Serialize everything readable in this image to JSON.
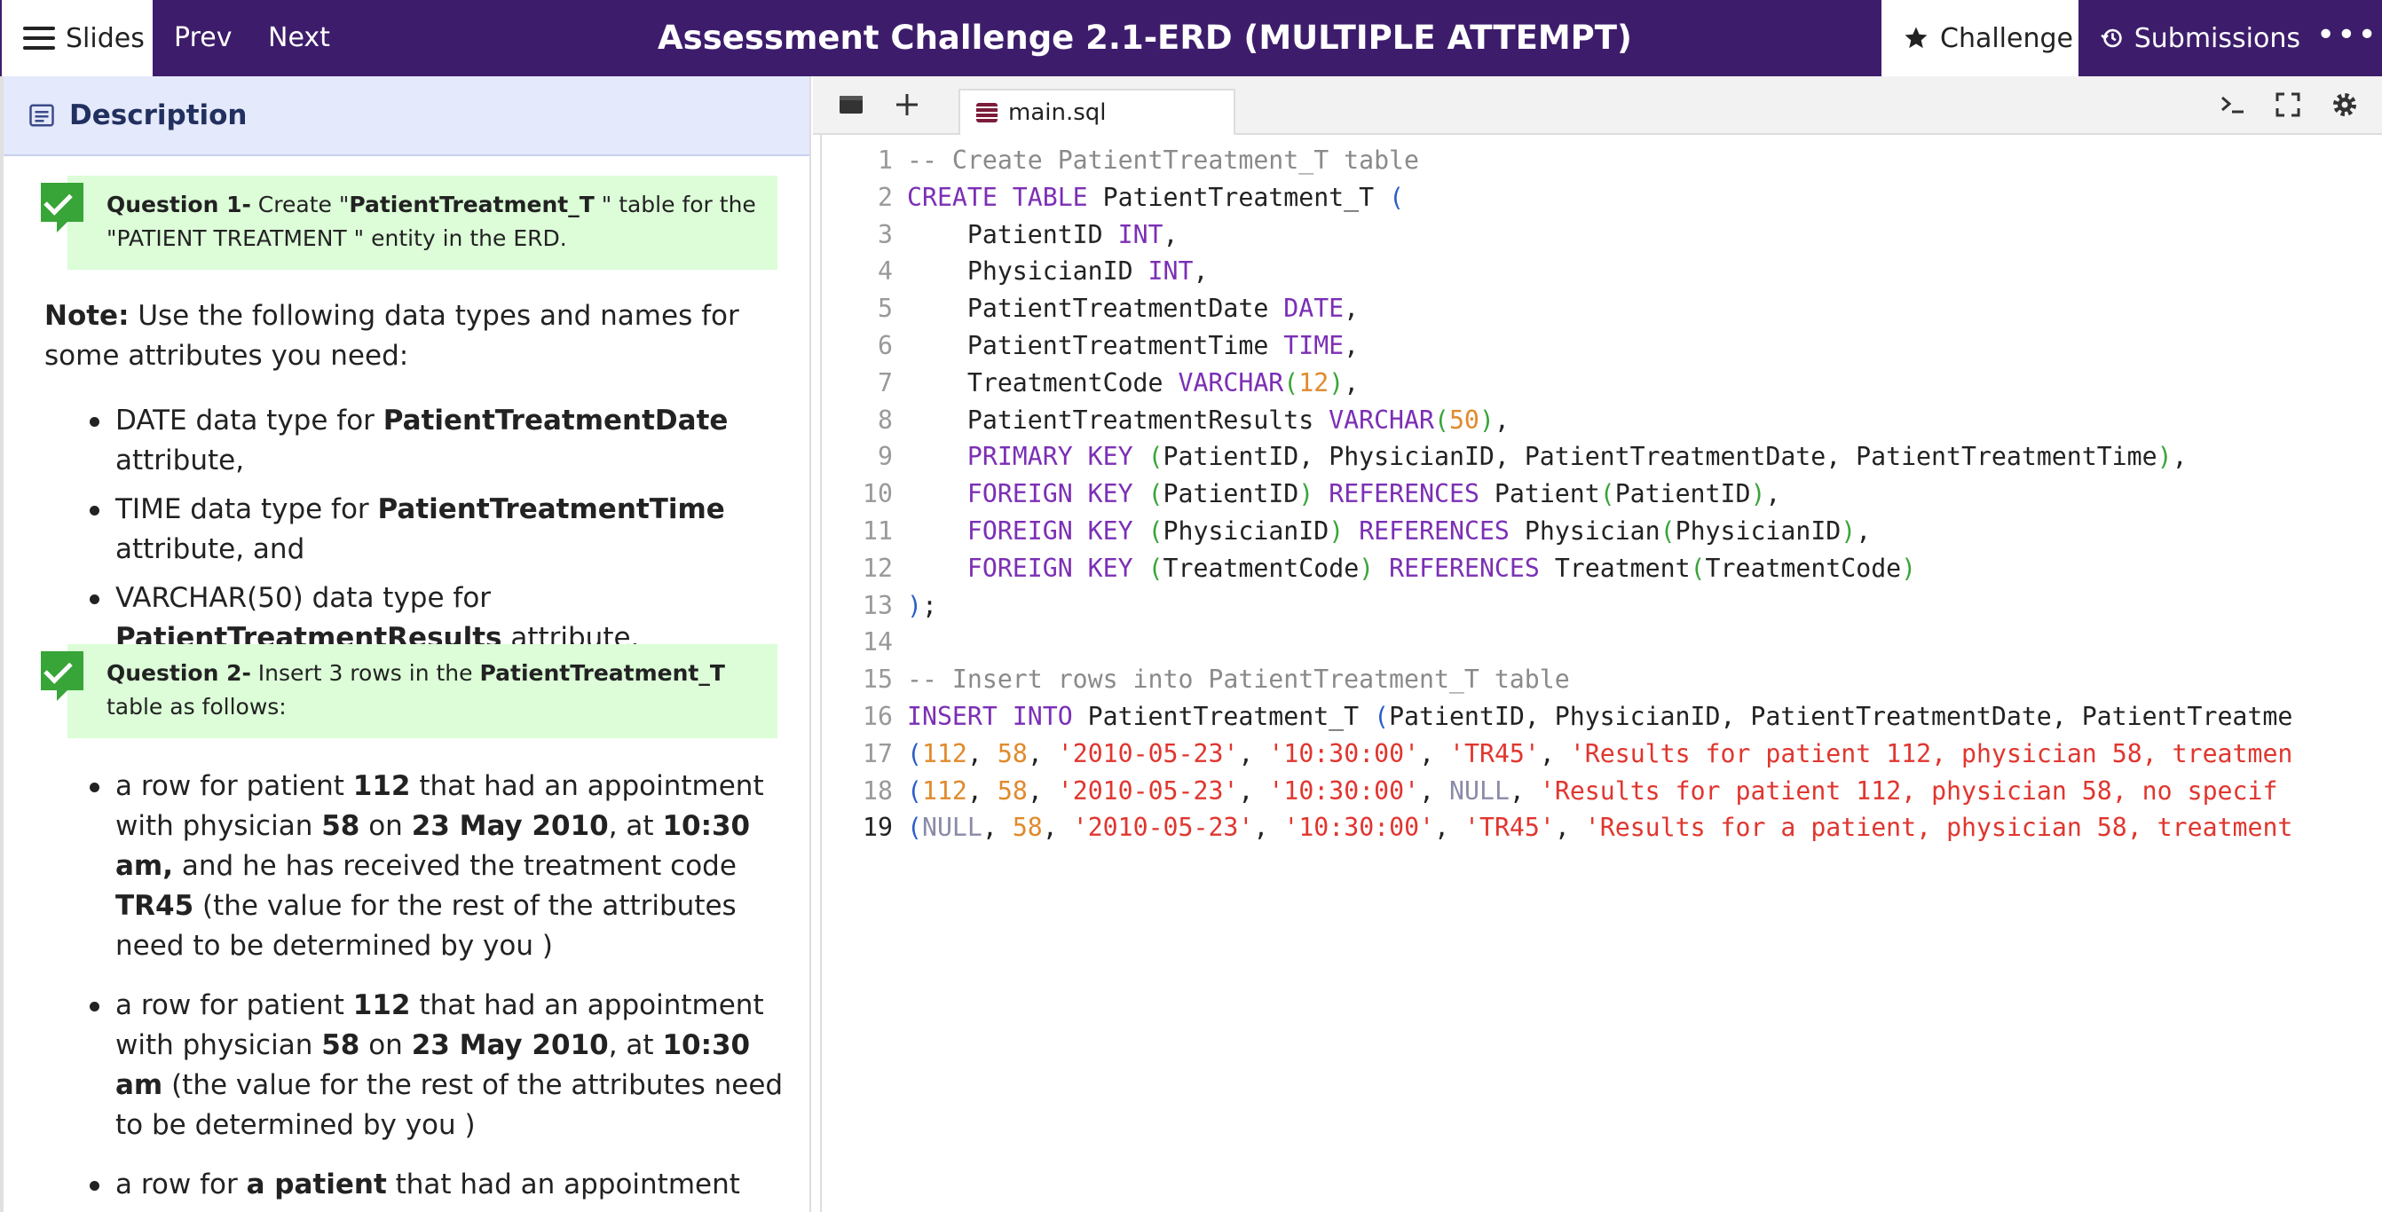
{
  "topbar": {
    "slides_label": "Slides",
    "prev_label": "Prev",
    "next_label": "Next",
    "title": "Assessment Challenge 2.1-ERD (MULTIPLE ATTEMPT)",
    "challenge_label": "Challenge",
    "submissions_label": "Submissions",
    "more_label": "•••"
  },
  "description": {
    "header": "Description",
    "q1": {
      "label": "Question 1-",
      "pre": " Create \"",
      "bold": "PatientTreatment_T",
      "post": " \" table for the \"PATIENT TREATMENT \" entity in the ERD."
    },
    "note": {
      "label": "Note:",
      "text": " Use the following data types and names for some attributes you need:"
    },
    "types": [
      {
        "pre": "DATE data type for ",
        "bold": "PatientTreatmentDate",
        "post": " attribute,"
      },
      {
        "pre": "TIME data type for ",
        "bold": "PatientTreatmentTime",
        "post": " attribute, and"
      },
      {
        "pre": "VARCHAR(50) data type for ",
        "bold": "PatientTreatmentResults",
        "post": " attribute."
      }
    ],
    "q2": {
      "label": "Question 2-",
      "pre": " Insert 3 rows in the ",
      "bold": "PatientTreatment_T",
      "post": " table as follows:"
    },
    "rows": [
      {
        "t1": "a row for patient ",
        "b1": "112",
        "t2": " that had an appointment with physician ",
        "b2": "58",
        "t3": " on ",
        "b3": "23 May 2010",
        "t4": ", at ",
        "b4": "10:30 am,",
        "t5": " and he has received the treatment code ",
        "b5": "TR45",
        "t6": "   (the value for the rest of the attributes need to be determined by you )"
      },
      {
        "t1": "a row for patient ",
        "b1": "112",
        "t2": " that had an appointment with physician ",
        "b2": "58",
        "t3": " on ",
        "b3": "23 May 2010",
        "t4": ", at ",
        "b4": "10:30 am",
        "t5": "  (the value for the rest of the attributes need to be determined by you )"
      },
      {
        "t1": "a row for ",
        "b1": "a patient",
        "t2": " that had an appointment with"
      }
    ]
  },
  "editor": {
    "tab_name": "main.sql",
    "icons": [
      "file-browser-icon",
      "plus-icon",
      "terminal-icon",
      "fullscreen-icon",
      "settings-icon"
    ],
    "current_line": 19,
    "lines": [
      {
        "n": "1",
        "tokens": [
          [
            "cm",
            "-- Create PatientTreatment_T table"
          ]
        ]
      },
      {
        "n": "2",
        "tokens": [
          [
            "kw",
            "CREATE TABLE"
          ],
          [
            "txt",
            " PatientTreatment_T "
          ],
          [
            "pb",
            "("
          ]
        ]
      },
      {
        "n": "3",
        "tokens": [
          [
            "txt",
            "    PatientID "
          ],
          [
            "ty",
            "INT"
          ],
          [
            "txt",
            ","
          ]
        ]
      },
      {
        "n": "4",
        "tokens": [
          [
            "txt",
            "    PhysicianID "
          ],
          [
            "ty",
            "INT"
          ],
          [
            "txt",
            ","
          ]
        ]
      },
      {
        "n": "5",
        "tokens": [
          [
            "txt",
            "    PatientTreatmentDate "
          ],
          [
            "ty",
            "DATE"
          ],
          [
            "txt",
            ","
          ]
        ]
      },
      {
        "n": "6",
        "tokens": [
          [
            "txt",
            "    PatientTreatmentTime "
          ],
          [
            "ty",
            "TIME"
          ],
          [
            "txt",
            ","
          ]
        ]
      },
      {
        "n": "7",
        "tokens": [
          [
            "txt",
            "    TreatmentCode "
          ],
          [
            "ty",
            "VARCHAR"
          ],
          [
            "pn",
            "("
          ],
          [
            "nm",
            "12"
          ],
          [
            "pn",
            ")"
          ],
          [
            "txt",
            ","
          ]
        ]
      },
      {
        "n": "8",
        "tokens": [
          [
            "txt",
            "    PatientTreatmentResults "
          ],
          [
            "ty",
            "VARCHAR"
          ],
          [
            "pn",
            "("
          ],
          [
            "nm",
            "50"
          ],
          [
            "pn",
            ")"
          ],
          [
            "txt",
            ","
          ]
        ]
      },
      {
        "n": "9",
        "tokens": [
          [
            "txt",
            "    "
          ],
          [
            "kw",
            "PRIMARY KEY"
          ],
          [
            "txt",
            " "
          ],
          [
            "pn",
            "("
          ],
          [
            "txt",
            "PatientID, PhysicianID, PatientTreatmentDate, PatientTreatmentTime"
          ],
          [
            "pn",
            ")"
          ],
          [
            "txt",
            ","
          ]
        ]
      },
      {
        "n": "10",
        "tokens": [
          [
            "txt",
            "    "
          ],
          [
            "kw",
            "FOREIGN KEY"
          ],
          [
            "txt",
            " "
          ],
          [
            "pn",
            "("
          ],
          [
            "txt",
            "PatientID"
          ],
          [
            "pn",
            ")"
          ],
          [
            "txt",
            " "
          ],
          [
            "kw",
            "REFERENCES"
          ],
          [
            "txt",
            " Patient"
          ],
          [
            "pn",
            "("
          ],
          [
            "txt",
            "PatientID"
          ],
          [
            "pn",
            ")"
          ],
          [
            "txt",
            ","
          ]
        ]
      },
      {
        "n": "11",
        "tokens": [
          [
            "txt",
            "    "
          ],
          [
            "kw",
            "FOREIGN KEY"
          ],
          [
            "txt",
            " "
          ],
          [
            "pn",
            "("
          ],
          [
            "txt",
            "PhysicianID"
          ],
          [
            "pn",
            ")"
          ],
          [
            "txt",
            " "
          ],
          [
            "kw",
            "REFERENCES"
          ],
          [
            "txt",
            " Physician"
          ],
          [
            "pn",
            "("
          ],
          [
            "txt",
            "PhysicianID"
          ],
          [
            "pn",
            ")"
          ],
          [
            "txt",
            ","
          ]
        ]
      },
      {
        "n": "12",
        "tokens": [
          [
            "txt",
            "    "
          ],
          [
            "kw",
            "FOREIGN KEY"
          ],
          [
            "txt",
            " "
          ],
          [
            "pn",
            "("
          ],
          [
            "txt",
            "TreatmentCode"
          ],
          [
            "pn",
            ")"
          ],
          [
            "txt",
            " "
          ],
          [
            "kw",
            "REFERENCES"
          ],
          [
            "txt",
            " Treatment"
          ],
          [
            "pn",
            "("
          ],
          [
            "txt",
            "TreatmentCode"
          ],
          [
            "pn",
            ")"
          ]
        ]
      },
      {
        "n": "13",
        "tokens": [
          [
            "pb",
            ")"
          ],
          [
            "txt",
            ";"
          ]
        ]
      },
      {
        "n": "14",
        "tokens": []
      },
      {
        "n": "15",
        "tokens": [
          [
            "cm",
            "-- Insert rows into PatientTreatment_T table"
          ]
        ]
      },
      {
        "n": "16",
        "tokens": [
          [
            "kw",
            "INSERT INTO"
          ],
          [
            "txt",
            " PatientTreatment_T "
          ],
          [
            "pb",
            "("
          ],
          [
            "txt",
            "PatientID, PhysicianID, PatientTreatmentDate, PatientTreatme"
          ]
        ]
      },
      {
        "n": "17",
        "tokens": [
          [
            "pb",
            "("
          ],
          [
            "nm",
            "112"
          ],
          [
            "txt",
            ", "
          ],
          [
            "nm",
            "58"
          ],
          [
            "txt",
            ", "
          ],
          [
            "st",
            "'2010-05-23'"
          ],
          [
            "txt",
            ", "
          ],
          [
            "st",
            "'10:30:00'"
          ],
          [
            "txt",
            ", "
          ],
          [
            "st",
            "'TR45'"
          ],
          [
            "txt",
            ", "
          ],
          [
            "st",
            "'Results for patient 112, physician 58, treatmen"
          ]
        ]
      },
      {
        "n": "18",
        "tokens": [
          [
            "pb",
            "("
          ],
          [
            "nm",
            "112"
          ],
          [
            "txt",
            ", "
          ],
          [
            "nm",
            "58"
          ],
          [
            "txt",
            ", "
          ],
          [
            "st",
            "'2010-05-23'"
          ],
          [
            "txt",
            ", "
          ],
          [
            "st",
            "'10:30:00'"
          ],
          [
            "txt",
            ", "
          ],
          [
            "nu",
            "NULL"
          ],
          [
            "txt",
            ", "
          ],
          [
            "st",
            "'Results for patient 112, physician 58, no specif"
          ]
        ]
      },
      {
        "n": "19",
        "tokens": [
          [
            "pb",
            "("
          ],
          [
            "nu",
            "NULL"
          ],
          [
            "txt",
            ", "
          ],
          [
            "nm",
            "58"
          ],
          [
            "txt",
            ", "
          ],
          [
            "st",
            "'2010-05-23'"
          ],
          [
            "txt",
            ", "
          ],
          [
            "st",
            "'10:30:00'"
          ],
          [
            "txt",
            ", "
          ],
          [
            "st",
            "'TR45'"
          ],
          [
            "txt",
            ", "
          ],
          [
            "st",
            "'Results for a patient, physician 58, treatment"
          ]
        ]
      }
    ]
  }
}
